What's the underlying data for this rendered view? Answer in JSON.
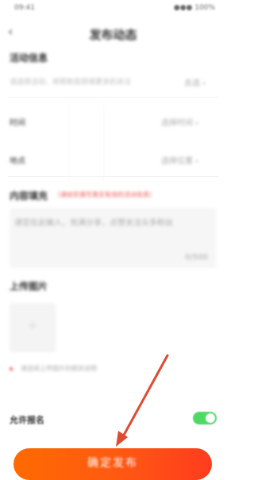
{
  "status_bar": {
    "left": "09:41",
    "right": "●●● 100%"
  },
  "nav": {
    "title": "发布动态",
    "back_glyph": "‹"
  },
  "activity_info": {
    "title": "活动信息",
    "value": "请选择活动，将帮助您获得更多的关注",
    "more": "去选 ›"
  },
  "time_row": {
    "label": "时间",
    "value": "选择时间 ›"
  },
  "location_row": {
    "label": "地点",
    "value": "选择位置 ›"
  },
  "content": {
    "title": "内容填充",
    "hint": "（请如实填写真实有效的活动信息）",
    "placeholder": "请您在此输入，充满分享，点赞关注众多粉丝",
    "counter": "0/500"
  },
  "upload": {
    "title": "上传图片",
    "plus": "+"
  },
  "notice": {
    "text": "请选择上传图片的相关说明"
  },
  "allow_signup": {
    "label": "允许报名",
    "enabled": true
  },
  "submit": {
    "label": "确定发布"
  },
  "colors": {
    "accent_start": "#ff6a00",
    "accent_end": "#ff3c1e",
    "toggle_on": "#4cd964",
    "hint_red": "#e8544e",
    "arrow": "#e04a30"
  },
  "icons": {
    "arrow": "red-pointer-arrow-icon",
    "back": "back-chevron-icon",
    "plus": "plus-icon"
  }
}
